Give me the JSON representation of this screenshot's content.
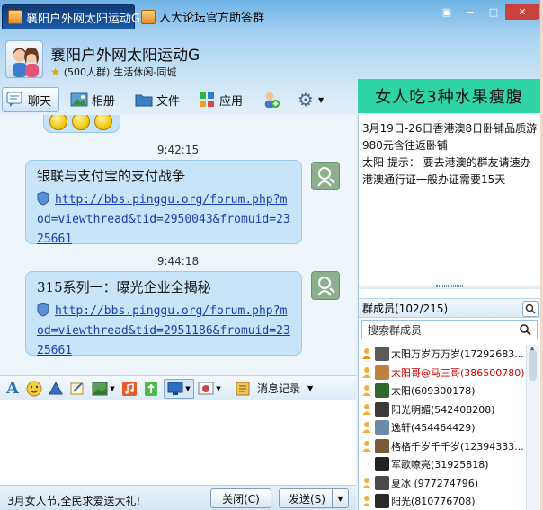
{
  "window": {
    "tabs": [
      {
        "label": "襄阳户外网太阳运动G",
        "active": true
      },
      {
        "label": "人大论坛官方助答群",
        "active": false
      }
    ],
    "controls": {
      "menu": "▣",
      "minimize": "−",
      "maximize": "□",
      "close": "✕"
    }
  },
  "header": {
    "group_name": "襄阳户外网太阳运动G",
    "member_count": "(500人群)",
    "category": "生活休闲-同城"
  },
  "toolbar": {
    "items": [
      {
        "label": "聊天",
        "icon": "chat-icon",
        "active": true
      },
      {
        "label": "相册",
        "icon": "album-icon"
      },
      {
        "label": "文件",
        "icon": "folder-icon"
      },
      {
        "label": "应用",
        "icon": "apps-icon"
      }
    ],
    "add_member_icon": "add-member-icon",
    "settings_icon": "gear-icon"
  },
  "ad_banner": "女人吃3种水果瘦腹",
  "messages": [
    {
      "time": "9:42:15",
      "title": "银联与支付宝的支付战争",
      "link": "http://bbs.pinggu.org/forum.php?mod=viewthread&tid=2950043&fromuid=2325661"
    },
    {
      "time": "9:44:18",
      "title": "315系列一：曝光企业全揭秘",
      "link": "http://bbs.pinggu.org/forum.php?mod=viewthread&tid=2951186&fromuid=2325661"
    }
  ],
  "input_toolbar": {
    "history_label": "消息记录"
  },
  "bottom": {
    "promo": "3月女人节,全民求爱送大礼!",
    "close_label": "关闭(C)",
    "send_label": "发送(S)"
  },
  "announcement": {
    "text": "3月19日-26日香港澳8日卧铺品质游980元含往返卧铺\n太阳 提示： 要去港澳的群友请速办港澳通行证一般办证需要15天"
  },
  "members": {
    "header": "群成员(102/215)",
    "search_placeholder": "搜索群成员",
    "list": [
      {
        "name": "太阳万岁万万岁(17292683...",
        "role": "owner",
        "highlight": false,
        "color": "#5a5a5a"
      },
      {
        "name": "太阳哥@马三哥(386500780)",
        "role": "admin",
        "highlight": true,
        "color": "#c08040"
      },
      {
        "name": "太阳(609300178)",
        "role": "admin",
        "highlight": false,
        "color": "#2d6b2d"
      },
      {
        "name": "阳光明媚(542408208)",
        "role": "admin",
        "highlight": false,
        "color": "#3a3a3a"
      },
      {
        "name": "逸轩(454464429)",
        "role": "admin",
        "highlight": false,
        "color": "#6a8aa8"
      },
      {
        "name": "格格千岁千千岁(12394333...",
        "role": "admin",
        "highlight": false,
        "color": "#7a5a3a"
      },
      {
        "name": "军歌嘹亮(31925818)",
        "role": "none",
        "highlight": false,
        "color": "#222222"
      },
      {
        "name": "夏冰 (977274796)",
        "role": "admin",
        "highlight": false,
        "color": "#4a4a4a"
      },
      {
        "name": "阳光(810776708)",
        "role": "admin",
        "highlight": false,
        "color": "#2a2a2a"
      }
    ]
  }
}
